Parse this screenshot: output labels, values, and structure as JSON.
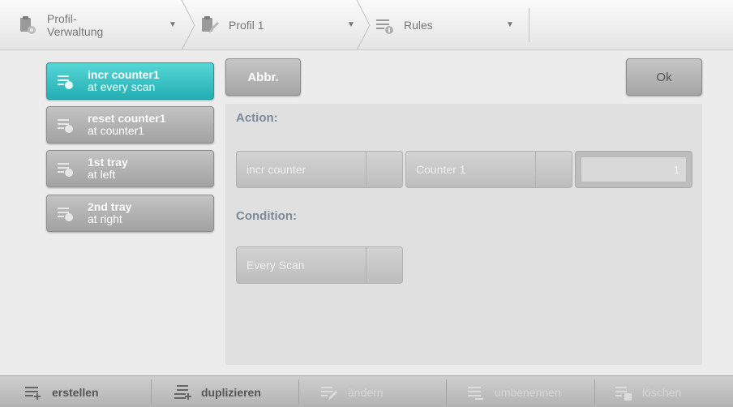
{
  "breadcrumb": {
    "profile_admin": "Profil-\nVerwaltung",
    "profile": "Profil 1",
    "rules": "Rules"
  },
  "rules": [
    {
      "line1": "incr counter1",
      "line2": "at every scan",
      "active": true
    },
    {
      "line1": "reset counter1",
      "line2": "at counter1",
      "active": false
    },
    {
      "line1": "1st tray",
      "line2": "at left",
      "active": false
    },
    {
      "line1": "2nd tray",
      "line2": "at right",
      "active": false
    }
  ],
  "buttons": {
    "cancel": "Abbr.",
    "ok": "Ok"
  },
  "action": {
    "label": "Action:",
    "type": "incr counter",
    "counter": "Counter 1",
    "value": "1"
  },
  "condition": {
    "label": "Condition:",
    "type": "Every Scan"
  },
  "toolbar": {
    "create": "erstellen",
    "duplicate": "duplizieren",
    "change": "ändern",
    "rename": "umbenennen",
    "delete": "löschen"
  },
  "colors": {
    "accent": "#2cb7bb",
    "section_label": "#7a8a99"
  },
  "icons": [
    "clipboard-gear-icon",
    "clipboard-edit-icon",
    "rules-icon",
    "chevron-down-icon",
    "rule-item-icon",
    "add-icon",
    "duplicate-icon",
    "edit-icon",
    "rename-icon",
    "delete-icon"
  ]
}
